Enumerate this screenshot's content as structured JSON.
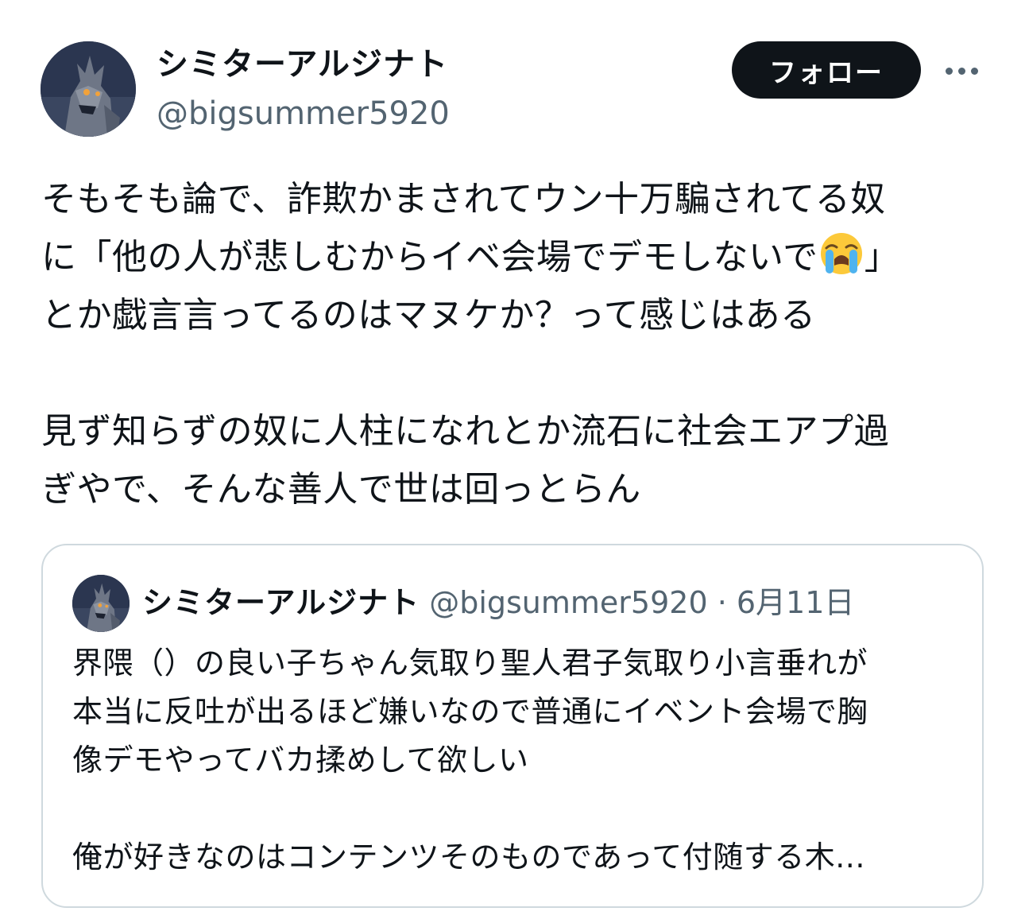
{
  "author": {
    "display_name": "シミターアルジナト",
    "handle": "@bigsummer5920",
    "avatar_icon": "monster-avatar"
  },
  "actions": {
    "follow_label": "フォロー",
    "more_icon": "more-horizontal-icon"
  },
  "tweet": {
    "line1": "そもそも論で、詐欺かまされてウン十万騙されてる奴",
    "line2_before_emoji": "に「他の人が悲しむからイベ会場でデモしないで",
    "line2_emoji": "loudly-crying-face-emoji",
    "line2_after_emoji": "」",
    "line3": "とか戯言言ってるのはマヌケか？って感じはある",
    "line4": "見ず知らずの奴に人柱になれとか流石に社会エアプ過",
    "line5": "ぎやで、そんな善人で世は回っとらん"
  },
  "quoted_tweet": {
    "display_name": "シミターアルジナト",
    "meta": "@bigsummer5920 · 6月11日",
    "line1": "界隈（）の良い子ちゃん気取り聖人君子気取り小言垂れが",
    "line2": "本当に反吐が出るほど嫌いなので普通にイベント会場で胸",
    "line3": "像デモやってバカ揉めして欲しい",
    "line4": "俺が好きなのはコンテンツそのものであって付随する木..."
  },
  "colors": {
    "text": "#0f1419",
    "secondary_text": "#536471",
    "border": "#cfd9de",
    "follow_button_bg": "#0f1419"
  }
}
